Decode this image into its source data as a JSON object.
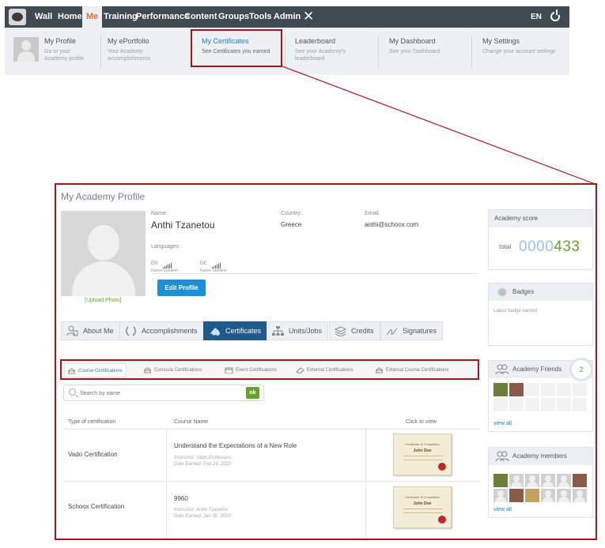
{
  "topnav": {
    "items": [
      "Wall",
      "Home",
      "Me",
      "Training",
      "Performance",
      "Content",
      "Groups",
      "Tools",
      "Admin"
    ],
    "active": "Me",
    "language": "EN"
  },
  "submenu": {
    "items": [
      {
        "title": "My Profile",
        "desc": "Go to your Academy profile"
      },
      {
        "title": "My ePortfolio",
        "desc": "Your Academy accomplishments"
      },
      {
        "title": "My Certificates",
        "desc": "See Certificates you earned"
      },
      {
        "title": "Leaderboard",
        "desc": "See your Academy's leaderboard"
      },
      {
        "title": "My Dashboard",
        "desc": "See your Dashboard"
      },
      {
        "title": "My Settings",
        "desc": "Change your account settings"
      }
    ]
  },
  "profile": {
    "title": "My Academy Profile",
    "upload_label": "[Upload Photo]",
    "name_label": "Name:",
    "name": "Anthi Tzanetou",
    "country_label": "Country:",
    "country": "Greece",
    "email_label": "Email:",
    "email": "anthi@schoox.com",
    "languages_label": "Languages:",
    "languages": [
      {
        "code": "EN",
        "level": "Native Speaker"
      },
      {
        "code": "DE",
        "level": "Native Speaker"
      }
    ],
    "edit_button": "Edit Profile"
  },
  "tabs": [
    "About Me",
    "Accomplishments",
    "Certificates",
    "Units/Jobs",
    "Credits",
    "Signatures"
  ],
  "active_tab": "Certificates",
  "cert_tabs": [
    "Course Certifications",
    "Curricula Certifications",
    "Event Certifications",
    "External Certifications",
    "External Course Certifications"
  ],
  "active_cert_tab": "Course Certifications",
  "search": {
    "placeholder": "Search by name",
    "button": "ok"
  },
  "table": {
    "headers": [
      "Type of certification",
      "Course Name",
      "Click to view"
    ],
    "rows": [
      {
        "type": "Vado Certification",
        "course": "Understand the Expectations of a New Role",
        "instructor": "Instructor: Vado Professors",
        "date": "Date Earned: Feb 26, 2020",
        "cert_title": "Certificate of Completion",
        "cert_name": "John Doe"
      },
      {
        "type": "Schoox Certification",
        "course": "9960",
        "instructor": "Instructor: Anthi Tzanetou",
        "date": "Date Earned: Jan 30, 2020",
        "cert_title": "Certificate of Completion",
        "cert_name": "John Doe"
      }
    ]
  },
  "sidebar": {
    "score": {
      "title": "Academy score",
      "total_label": "total",
      "zeros": "0000",
      "value": "433"
    },
    "badges": {
      "title": "Badges",
      "latest": "Latest badge earned"
    },
    "friends": {
      "title": "Academy Friends",
      "count": "2",
      "view_all": "view all"
    },
    "members": {
      "title": "Academy members",
      "view_all": "view all"
    }
  },
  "colors": {
    "nav_bg": "#3f4a52",
    "active_orange": "#e46d2c",
    "highlight_red": "#a6141c",
    "button_blue": "#1c8fd7",
    "score_green": "#6aa12b",
    "active_tab": "#1f5a8a"
  }
}
